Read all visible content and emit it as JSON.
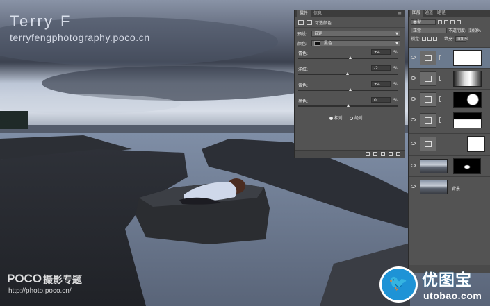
{
  "watermark": {
    "title": "Terry F",
    "url": "terryfengphotography.poco.cn"
  },
  "poco": {
    "logo": "POCO",
    "subtitle": "摄影专题",
    "url": "http://photo.poco.cn/"
  },
  "properties": {
    "tabs": [
      "属性",
      "信息"
    ],
    "adjustment_name": "可选颜色",
    "preset_label": "预设:",
    "preset_value": "自定",
    "colors_label": "颜色:",
    "colors_value": "黑色",
    "sliders": [
      {
        "name": "青色:",
        "value": "+4",
        "unit": "%",
        "level": 0.52
      },
      {
        "name": "洋红:",
        "value": "-2",
        "unit": "%",
        "level": 0.49
      },
      {
        "name": "黄色:",
        "value": "+4",
        "unit": "%",
        "level": 0.52
      },
      {
        "name": "黑色:",
        "value": "0",
        "unit": "%",
        "level": 0.5
      }
    ],
    "method_relative": "相对",
    "method_absolute": "绝对"
  },
  "layers": {
    "tabs": [
      "图层",
      "通道",
      "路径"
    ],
    "kind": "类型",
    "blend_mode": "正常",
    "opacity_label": "不透明度:",
    "opacity": "100%",
    "lock_label": "锁定:",
    "fill_label": "填充:",
    "fill": "100%",
    "background_layer_name": "背景"
  },
  "brand": {
    "name_cn": "优图宝",
    "url": "utobao.com",
    "color": "#1e93d6"
  }
}
